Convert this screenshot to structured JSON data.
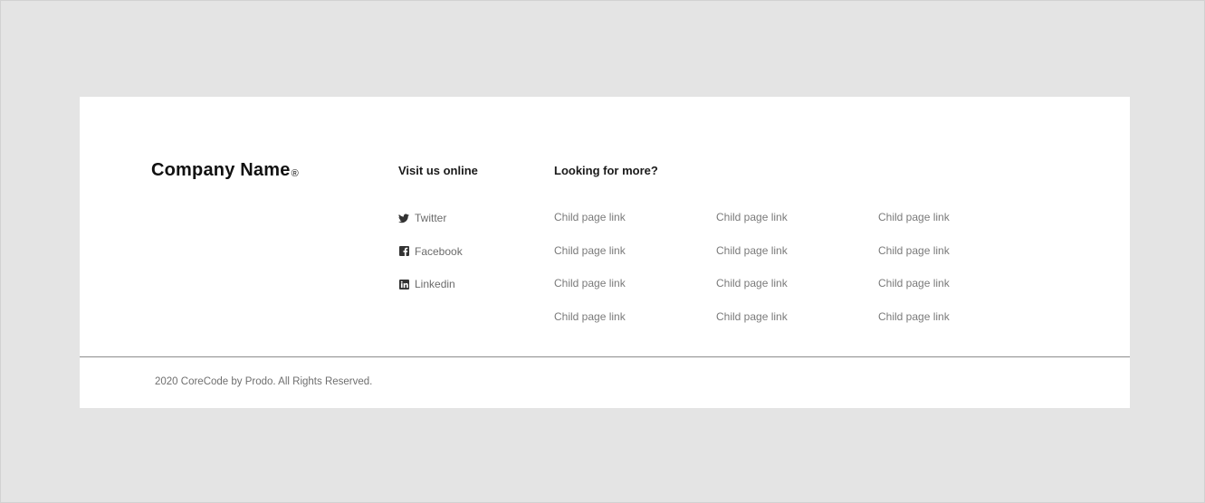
{
  "brand": {
    "name": "Company Name",
    "reg_mark": "®"
  },
  "social": {
    "heading": "Visit us online",
    "items": [
      {
        "label": "Twitter",
        "icon": "twitter-icon"
      },
      {
        "label": "Facebook",
        "icon": "facebook-icon"
      },
      {
        "label": "Linkedin",
        "icon": "linkedin-icon"
      }
    ]
  },
  "links": {
    "heading": "Looking for more?",
    "columns": [
      [
        "Child page link",
        "Child page link",
        "Child page link",
        "Child page link"
      ],
      [
        "Child page link",
        "Child page link",
        "Child page link",
        "Child page link"
      ],
      [
        "Child page link",
        "Child page link",
        "Child page link",
        "Child page link"
      ]
    ]
  },
  "footer": {
    "copyright": "2020 CoreCode by Prodo. All Rights Reserved."
  },
  "colors": {
    "page_bg": "#e4e4e4",
    "card_bg": "#ffffff",
    "divider": "#8c8c8c",
    "text": "#1a1a1a",
    "muted": "#7a7a7a"
  }
}
